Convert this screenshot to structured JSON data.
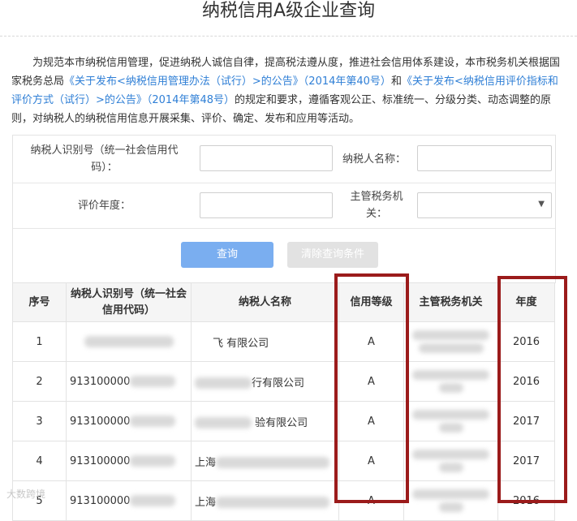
{
  "page": {
    "title": "纳税信用A级企业查询",
    "intro_parts": [
      {
        "t": "为规范本市纳税信用管理，促进纳税人诚信自律，提高税法遵从度，推进社会信用体系建设，本市税务机关根据国家税务总局",
        "link": false
      },
      {
        "t": "《关于发布<纳税信用管理办法（试行）>的公告》（2014年第40号）",
        "link": true
      },
      {
        "t": "和",
        "link": false
      },
      {
        "t": "《关于发布<纳税信用评价指标和评价方式（试行）>的公告》（2014年第48号）",
        "link": true
      },
      {
        "t": "的规定和要求，遵循客观公正、标准统一、分级分类、动态调整的原则，对纳税人的纳税信用信息开展采集、评价、确定、发布和应用等活动。",
        "link": false
      }
    ]
  },
  "form": {
    "taxpayer_id_label": "纳税人识别号（统一社会信用代码）：",
    "taxpayer_name_label": "纳税人名称：",
    "year_label": "评价年度：",
    "tax_office_label": "主管税务机关：",
    "taxpayer_id_value": "",
    "taxpayer_name_value": "",
    "year_value": "",
    "tax_office_value": "",
    "query_button": "查询",
    "clear_button": "清除查询条件"
  },
  "table": {
    "headers": [
      "序号",
      "纳税人识别号（统一社会信用代码）",
      "纳税人名称",
      "信用等级",
      "主管税务机关",
      "年度"
    ],
    "rows": [
      {
        "no": "1",
        "id": "",
        "name": "飞        有限公司",
        "grade": "A",
        "office": "",
        "year": "2016"
      },
      {
        "no": "2",
        "id": "913100000",
        "name": "行有限公司",
        "grade": "A",
        "office": "",
        "year": "2016"
      },
      {
        "no": "3",
        "id": "913100000",
        "name": "       验有限公司",
        "grade": "A",
        "office": "",
        "year": "2017"
      },
      {
        "no": "4",
        "id": "913100000",
        "name": "上海",
        "grade": "A",
        "office": "",
        "year": "2017"
      },
      {
        "no": "5",
        "id": "913100000",
        "name": "上海",
        "grade": "A",
        "office": "",
        "year": "2016"
      }
    ]
  },
  "watermark": "大数跨境",
  "colors": {
    "link": "#2f7fd6",
    "highlight": "#9b1b1b",
    "query_btn": "#7aaef0",
    "clear_btn": "#e2e2e2"
  }
}
